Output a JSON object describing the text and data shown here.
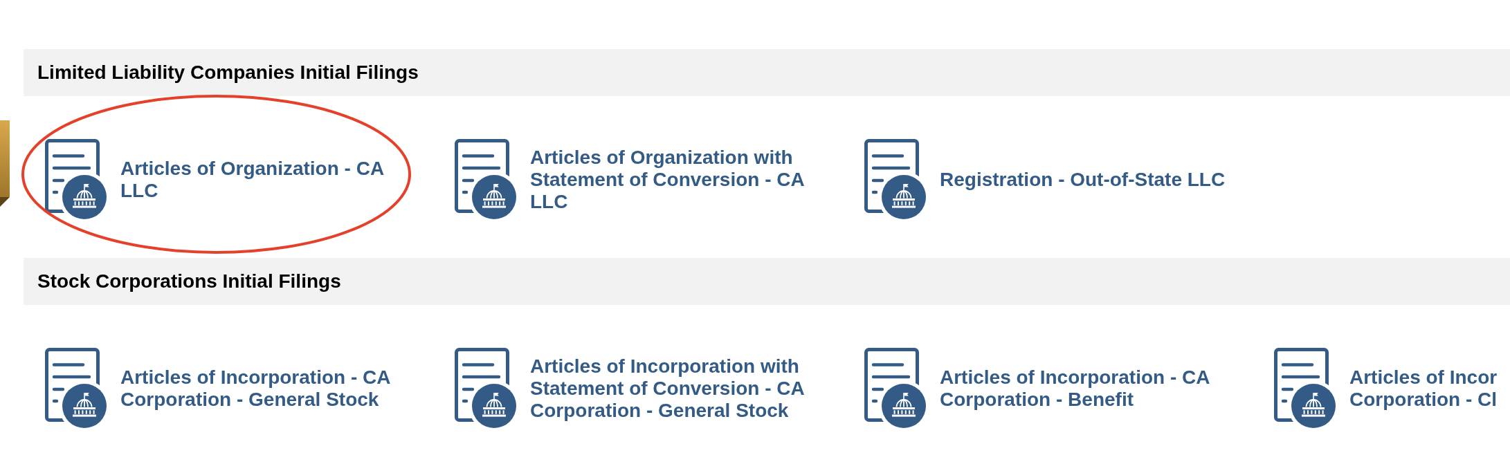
{
  "sections": [
    {
      "title": "Limited Liability Companies Initial Filings",
      "items": [
        {
          "label": "Articles of Organization - CA LLC",
          "circled": true
        },
        {
          "label": "Articles of Organization with Statement of Conversion - CA LLC",
          "circled": false
        },
        {
          "label": "Registration - Out-of-State LLC",
          "circled": false
        }
      ]
    },
    {
      "title": "Stock Corporations Initial Filings",
      "items": [
        {
          "label": "Articles of Incorporation - CA Corporation - General Stock",
          "circled": false
        },
        {
          "label": "Articles of Incorporation with Statement of Conversion - CA Corporation - General Stock",
          "circled": false
        },
        {
          "label": "Articles of Incorporation - CA Corporation - Benefit",
          "circled": false
        },
        {
          "label": "Articles of Incor Corporation - Cl",
          "circled": false
        }
      ]
    }
  ]
}
